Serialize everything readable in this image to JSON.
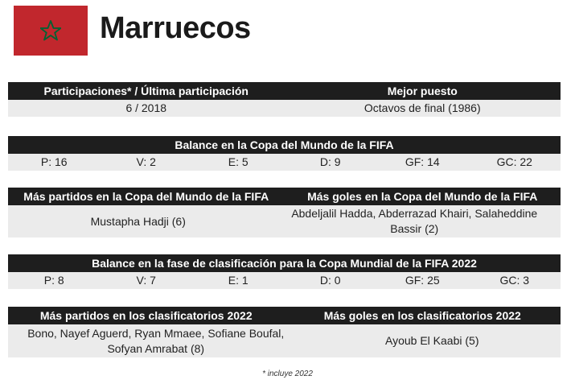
{
  "country": {
    "name": "Marruecos",
    "flag_icon": "morocco-flag-icon",
    "flag_color": "#c1272d",
    "star_color": "#006233"
  },
  "participation": {
    "headers": [
      "Participaciones* / Última participación",
      "Mejor puesto"
    ],
    "values": [
      "6 / 2018",
      "Octavos de final (1986)"
    ]
  },
  "world_cup_balance": {
    "title": "Balance en la Copa del Mundo de la FIFA",
    "stats": [
      "P: 16",
      "V: 2",
      "E: 5",
      "D: 9",
      "GF: 14",
      "GC: 22"
    ]
  },
  "world_cup_records": {
    "headers": [
      "Más partidos en la Copa del Mundo de la FIFA",
      "Más goles en la Copa del Mundo de la FIFA"
    ],
    "values": [
      "Mustapha Hadji (6)",
      "Abdeljalil Hadda, Abderrazad Khairi, Salaheddine Bassir (2)"
    ]
  },
  "qualifiers_balance": {
    "title": "Balance en la fase de clasificación para la Copa Mundial de la FIFA 2022",
    "stats": [
      "P: 8",
      "V: 7",
      "E: 1",
      "D: 0",
      "GF: 25",
      "GC: 3"
    ]
  },
  "qualifiers_records": {
    "headers": [
      "Más partidos en los clasificatorios 2022",
      "Más goles en los clasificatorios 2022"
    ],
    "values": [
      "Bono, Nayef Aguerd, Ryan Mmaee, Sofiane Boufal, Sofyan Amrabat (8)",
      "Ayoub El Kaabi (5)"
    ]
  },
  "footnote": "* incluye 2022"
}
